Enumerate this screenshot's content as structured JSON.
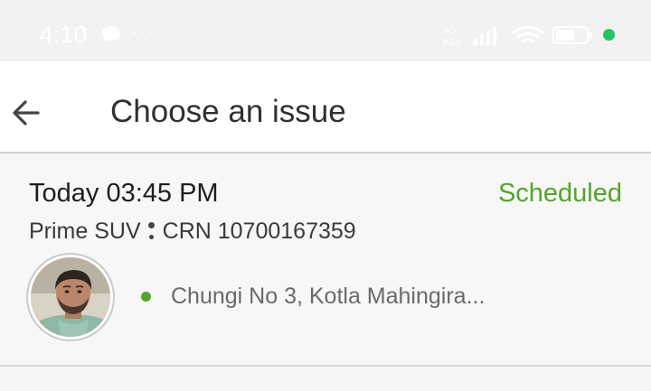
{
  "status_bar": {
    "time": "4:10",
    "more_indicator": "···",
    "network_label": "4G",
    "network_sub": "KB/s"
  },
  "header": {
    "title": "Choose an issue",
    "back_icon": "arrow-left-icon"
  },
  "ride": {
    "datetime": "Today 03:45 PM",
    "status": "Scheduled",
    "vehicle": "Prime SUV",
    "crn": "CRN 10700167359",
    "pickup": "Chungi No 3, Kotla Mahingira...",
    "colors": {
      "status": "#52a62c",
      "pickup_dot": "#52a62c"
    }
  }
}
